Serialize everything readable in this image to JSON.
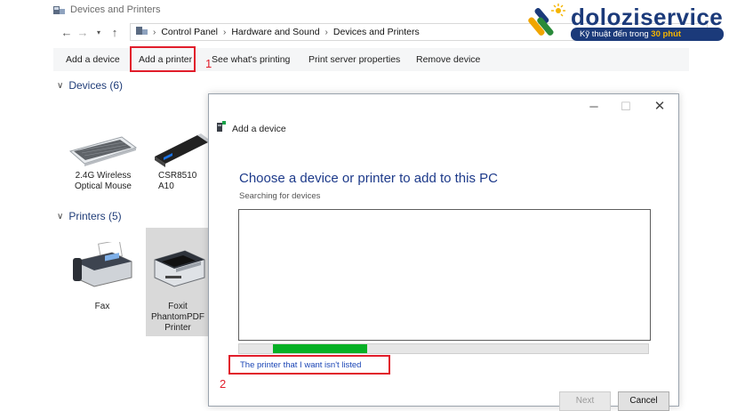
{
  "window": {
    "title": "Devices and Printers"
  },
  "breadcrumb": [
    "Control Panel",
    "Hardware and Sound",
    "Devices and Printers"
  ],
  "toolbar": {
    "items": [
      "Add a device",
      "Add a printer",
      "See what's printing",
      "Print server properties",
      "Remove device"
    ],
    "step1_marker": "1"
  },
  "devices_section": {
    "header": "Devices (6)",
    "items": [
      {
        "label_lines": [
          "2.4G Wireless",
          "Optical Mouse"
        ],
        "icon": "keyboard-icon"
      },
      {
        "label_lines": [
          "CSR8510 A10"
        ],
        "icon": "usb-dongle-icon"
      }
    ]
  },
  "printers_section": {
    "header": "Printers (5)",
    "items": [
      {
        "label_lines": [
          "Fax"
        ],
        "icon": "fax-icon"
      },
      {
        "label_lines": [
          "Foxit",
          "PhantomPDF",
          "Printer"
        ],
        "icon": "printer-icon"
      }
    ]
  },
  "dialog": {
    "title": "Add a device",
    "heading": "Choose a device or printer to add to this PC",
    "status": "Searching for devices",
    "progress_percent": 23,
    "link": "The printer that I want isn't listed",
    "step2_marker": "2",
    "buttons": {
      "next": "Next",
      "cancel": "Cancel"
    }
  },
  "logo": {
    "brand": "doloziservice",
    "tagline_prefix": "Kỹ thuật đến trong",
    "tagline_highlight": "30 phút"
  },
  "colors": {
    "highlight_red": "#e11d2b",
    "heading_blue": "#1d3a8a",
    "progress_green": "#06b025",
    "link_blue": "#1a45b5"
  }
}
